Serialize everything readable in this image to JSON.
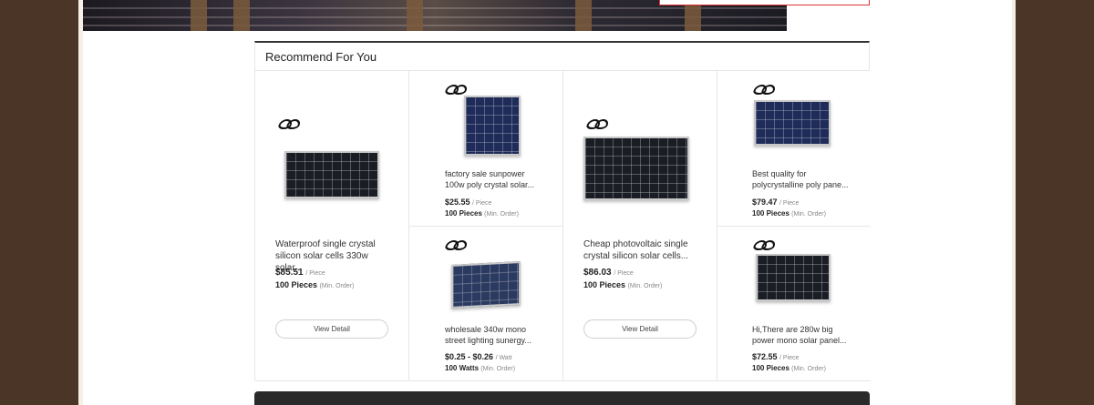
{
  "section": {
    "title": "Recommend For You"
  },
  "products": [
    {
      "title_line1": "Waterproof single crystal",
      "title_line2": "silicon solar cells 330w solar...",
      "price": "$85.51",
      "price_unit": "/ Piece",
      "moq": "100 Pieces",
      "moq_note": "(Min. Order)",
      "button": "View Detail"
    },
    {
      "title_line1": "factory sale sunpower",
      "title_line2": "100w poly crystal solar...",
      "price": "$25.55",
      "price_unit": "/ Piece",
      "moq": "100 Pieces",
      "moq_note": "(Min. Order)"
    },
    {
      "title_line1": "wholesale 340w mono",
      "title_line2": "street lighting sunergy...",
      "price": "$0.25 - $0.26",
      "price_unit": "/ Watt",
      "moq": "100 Watts",
      "moq_note": "(Min. Order)"
    },
    {
      "title_line1": "Cheap photovoltaic single",
      "title_line2": "crystal silicon solar cells...",
      "price": "$86.03",
      "price_unit": "/ Piece",
      "moq": "100 Pieces",
      "moq_note": "(Min. Order)",
      "button": "View Detail"
    },
    {
      "title_line1": "Best quality for",
      "title_line2": "polycrystalline poly pane...",
      "price": "$79.47",
      "price_unit": "/ Piece",
      "moq": "100 Pieces",
      "moq_note": "(Min. Order)"
    },
    {
      "title_line1": "Hi,There are 280w big",
      "title_line2": "power mono solar panel...",
      "price": "$72.55",
      "price_unit": "/ Piece",
      "moq": "100 Pieces",
      "moq_note": "(Min. Order)"
    }
  ]
}
